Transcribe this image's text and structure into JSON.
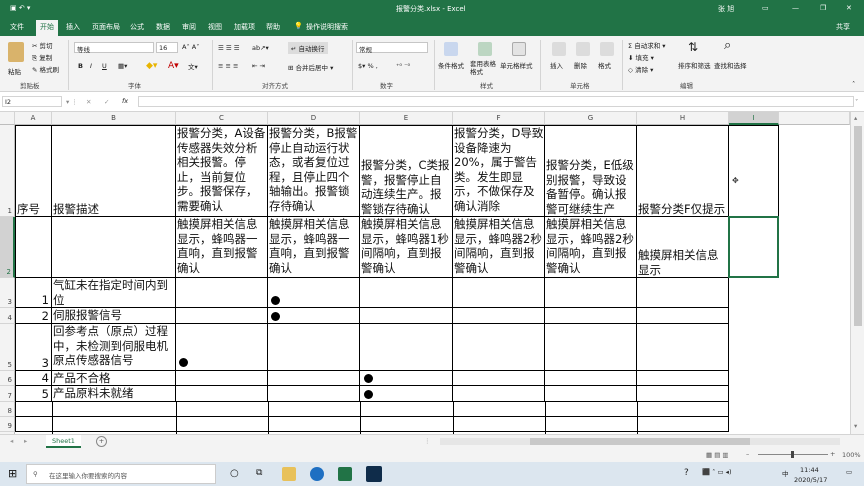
{
  "title_bar": {
    "autosave_icon": "save-icon",
    "doc_title": "报警分类.xlsx  -  Excel",
    "user": "张 旭",
    "accent": "#217346"
  },
  "tabs": [
    "文件",
    "开始",
    "插入",
    "页面布局",
    "公式",
    "数据",
    "审阅",
    "视图",
    "加载项",
    "帮助"
  ],
  "tell_me": "操作说明搜索",
  "share": "共享",
  "ribbon": {
    "clipboard": {
      "cut": "剪切",
      "copy": "复制",
      "format_painter": "格式刷",
      "paste": "粘贴",
      "group": "剪贴板"
    },
    "font": {
      "name": "等线",
      "size": "16",
      "bold": "B",
      "italic": "I",
      "underline": "U",
      "group": "字体"
    },
    "alignment": {
      "wrap": "自动换行",
      "merge": "合并后居中",
      "group": "对齐方式"
    },
    "number": {
      "format": "常规",
      "group": "数字"
    },
    "styles": {
      "conditional": "条件格式",
      "table": "套用表格格式",
      "cell_styles": "单元格样式",
      "group": "样式"
    },
    "cells": {
      "insert": "插入",
      "delete": "删除",
      "format": "格式",
      "group": "单元格"
    },
    "editing": {
      "autosum": "自动求和",
      "fill": "填充",
      "clear": "清除",
      "sort": "排序和筛选",
      "find": "查找和选择",
      "group": "编辑"
    }
  },
  "formula_bar": {
    "name_box": "I2",
    "fx": "fx",
    "content": ""
  },
  "columns": [
    "A",
    "B",
    "C",
    "D",
    "E",
    "F",
    "G",
    "H",
    "I"
  ],
  "rows": [
    "1",
    "2",
    "3",
    "4",
    "5",
    "6",
    "7",
    "8",
    "9",
    "10"
  ],
  "sheet": {
    "r1": {
      "a": "序号",
      "b": "报警描述",
      "c": "报警分类，A设备传感器失效分析相关报警。停止，当前复位步。报警保存，需要确认",
      "d": "报警分类，B报警停止自动运行状态，或者复位过程，且停止四个轴输出。报警锁存待确认",
      "e": "报警分类，C类报警，报警停止自动连续生产。报警锁存待确认",
      "f": "报警分类，D导致设备降速为20%，属于警告类。发生即显示，不做保存及确认消除",
      "g": "报警分类，E低级别报警，导致设备暂停。确认报警可继续生产",
      "h": "报警分类F仅提示"
    },
    "r2": {
      "c": "触摸屏相关信息显示，蜂鸣器一直响，直到报警确认",
      "d": "触摸屏相关信息显示，蜂鸣器一直响，直到报警确认",
      "e": "触摸屏相关信息显示，蜂鸣器1秒间隔响，直到报警确认",
      "f": "触摸屏相关信息显示，蜂鸣器2秒间隔响，直到报警确认",
      "g": "触摸屏相关信息显示，蜂鸣器2秒间隔响，直到报警确认",
      "h": "触摸屏相关信息显示"
    },
    "items": [
      {
        "no": "1",
        "desc": "气缸未在指定时间内到位"
      },
      {
        "no": "2",
        "desc": "伺服报警信号"
      },
      {
        "no": "3",
        "desc": "回参考点（原点）过程中，未检测到伺服电机原点传感器信号"
      },
      {
        "no": "4",
        "desc": "产品不合格"
      },
      {
        "no": "5",
        "desc": "产品原料未就绪"
      }
    ]
  },
  "sheet_tab": "Sheet1",
  "add_sheet": "+",
  "zoom": "100%",
  "taskbar": {
    "search_placeholder": "在这里输入你要搜索的内容",
    "time": "11:44",
    "date": "2020/5/17",
    "lang": "中"
  }
}
